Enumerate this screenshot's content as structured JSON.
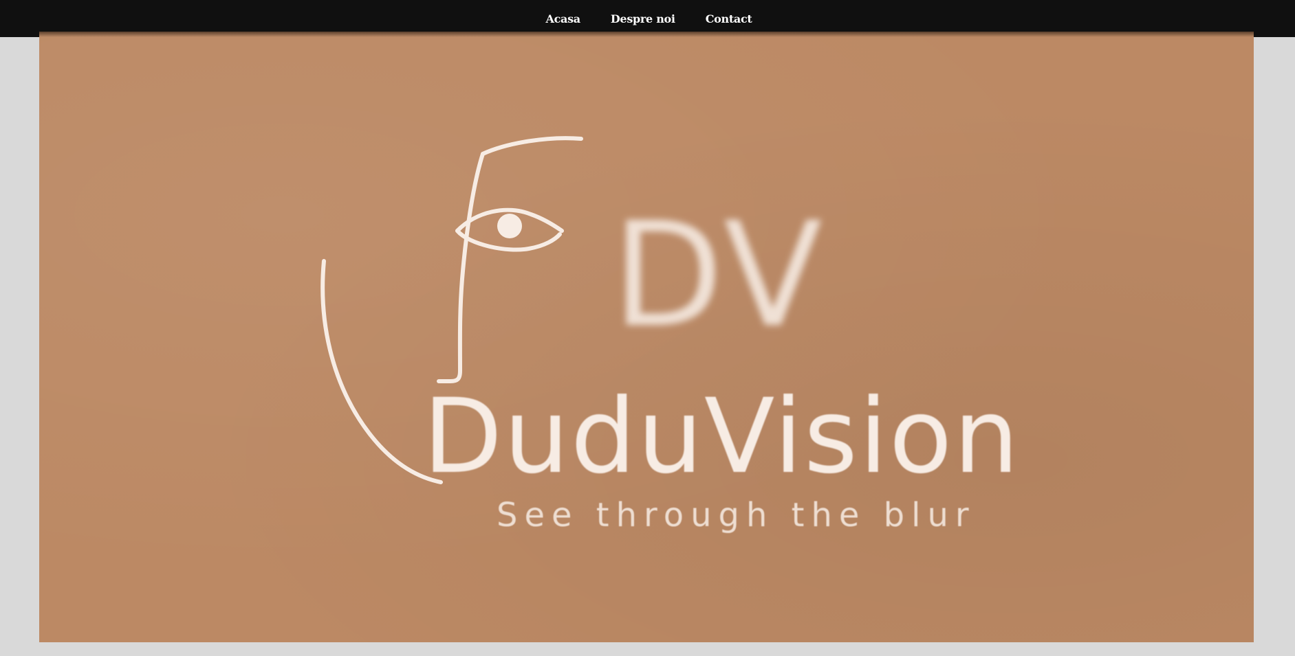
{
  "nav": {
    "items": [
      {
        "label": "Acasa"
      },
      {
        "label": "Despre noi"
      },
      {
        "label": "Contact"
      }
    ]
  },
  "hero": {
    "monogram": "DV",
    "brand_name": "DuduVision",
    "tagline": "See through the blur",
    "background_color": "#bc8964",
    "logo_color": "#f7ece4"
  },
  "colors": {
    "page_background": "#d9d9d9",
    "navbar_background": "#101010",
    "nav_text": "#ffffff"
  }
}
